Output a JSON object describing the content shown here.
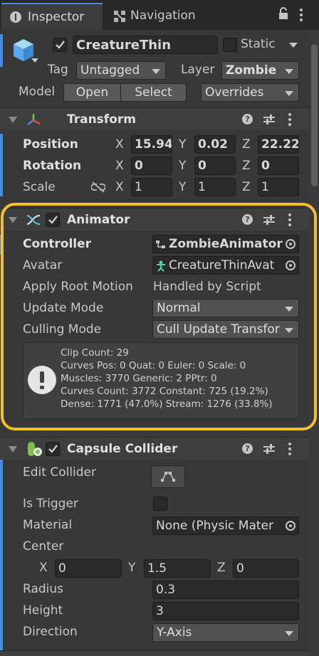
{
  "tabs": {
    "inspector": "Inspector",
    "navigation": "Navigation"
  },
  "object": {
    "name": "CreatureThin",
    "static_label": "Static",
    "tag_label": "Tag",
    "tag_value": "Untagged",
    "layer_label": "Layer",
    "layer_value": "Zombie",
    "model_label": "Model",
    "open_label": "Open",
    "select_label": "Select",
    "overrides_label": "Overrides"
  },
  "transform": {
    "title": "Transform",
    "position_label": "Position",
    "rotation_label": "Rotation",
    "scale_label": "Scale",
    "x": "X",
    "y": "Y",
    "z": "Z",
    "position": {
      "x": "15.94",
      "y": "0.02",
      "z": "22.22"
    },
    "rotation": {
      "x": "0",
      "y": "0",
      "z": "0"
    },
    "scale": {
      "x": "1",
      "y": "1",
      "z": "1"
    }
  },
  "animator": {
    "title": "Animator",
    "controller_label": "Controller",
    "controller_value": "ZombieAnimator",
    "avatar_label": "Avatar",
    "avatar_value": "CreatureThinAvat",
    "apply_root_label": "Apply Root Motion",
    "apply_root_value": "Handled by Script",
    "update_mode_label": "Update Mode",
    "update_mode_value": "Normal",
    "culling_mode_label": "Culling Mode",
    "culling_mode_value": "Cull Update Transfor",
    "info": [
      "Clip Count: 29",
      "Curves Pos: 0 Quat: 0 Euler: 0 Scale: 0",
      "Muscles: 3770 Generic: 2 PPtr: 0",
      "Curves Count: 3772 Constant: 725 (19.2%)",
      "Dense: 1771 (47.0%) Stream: 1276 (33.8%)"
    ]
  },
  "capsule": {
    "title": "Capsule Collider",
    "edit_collider_label": "Edit Collider",
    "is_trigger_label": "Is Trigger",
    "material_label": "Material",
    "material_value": "None (Physic Mater",
    "center_label": "Center",
    "x": "X",
    "y": "Y",
    "z": "Z",
    "center": {
      "x": "0",
      "y": "1.5",
      "z": "0"
    },
    "radius_label": "Radius",
    "radius_value": "0.3",
    "height_label": "Height",
    "height_value": "3",
    "direction_label": "Direction",
    "direction_value": "Y-Axis"
  },
  "colors": {
    "highlight": "#f5c02b",
    "accent_blue": "#4a8de0",
    "background": "#383838"
  }
}
